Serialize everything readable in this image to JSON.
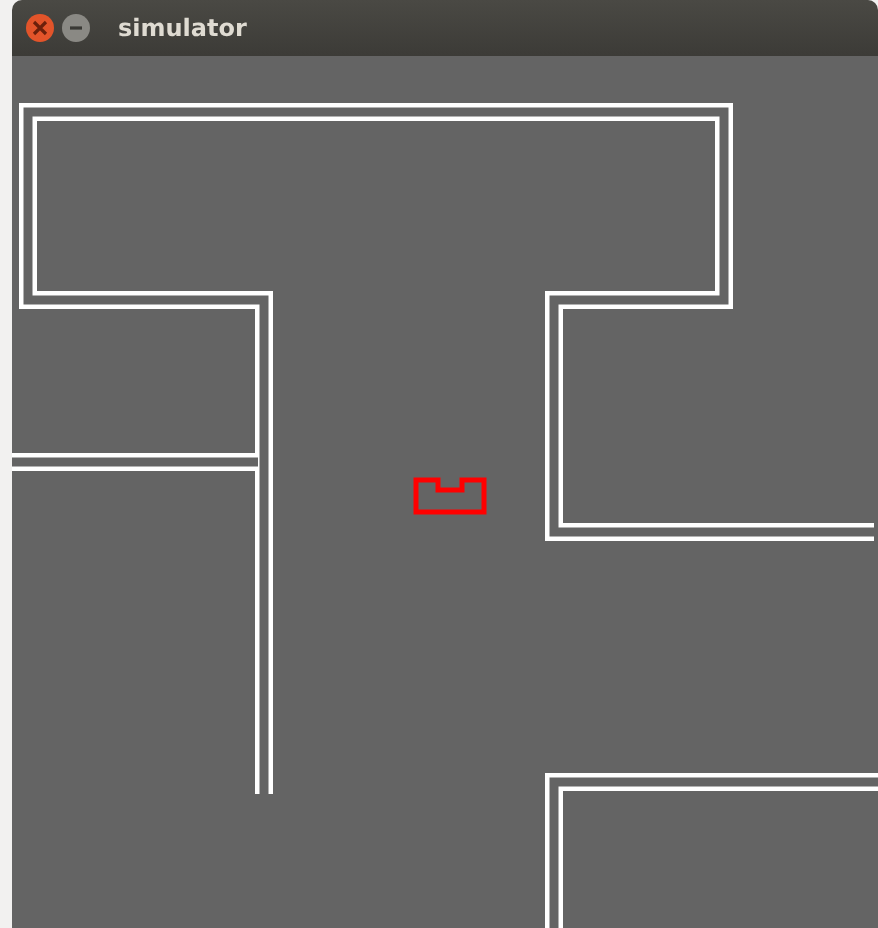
{
  "window": {
    "title": "simulator"
  }
}
